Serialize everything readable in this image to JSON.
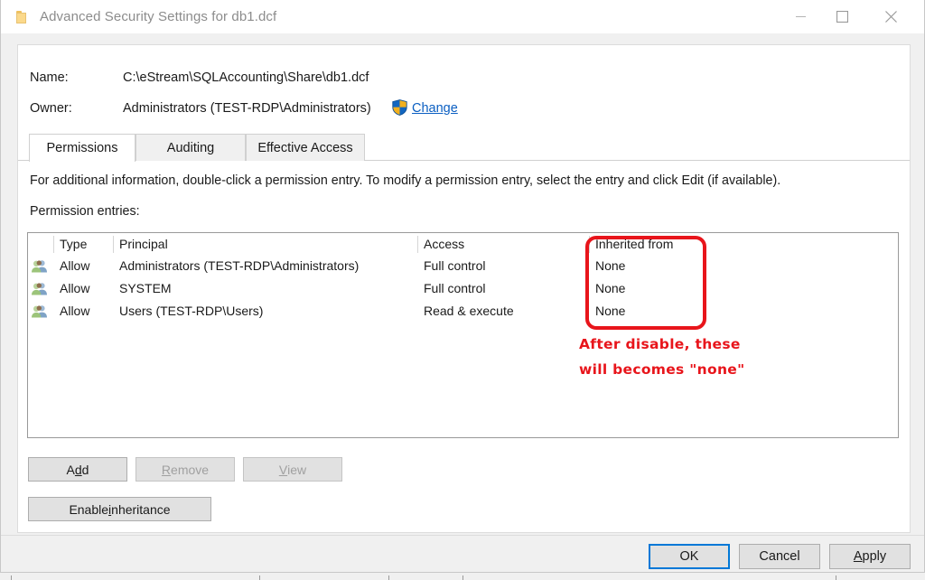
{
  "window": {
    "title": "Advanced Security Settings for db1.dcf",
    "icon": "folder-icon",
    "controls": {
      "minimize": "minimize-icon",
      "maximize": "maximize-icon",
      "close": "close-icon"
    }
  },
  "info": {
    "name_label": "Name:",
    "name_value": "C:\\eStream\\SQLAccounting\\Share\\db1.dcf",
    "owner_label": "Owner:",
    "owner_value": "Administrators (TEST-RDP\\Administrators)",
    "change_link": "Change",
    "shield_icon": "uac-shield-icon"
  },
  "tabs": [
    {
      "label": "Permissions",
      "active": true
    },
    {
      "label": "Auditing",
      "active": false
    },
    {
      "label": "Effective Access",
      "active": false
    }
  ],
  "main": {
    "description": "For additional information, double-click a permission entry. To modify a permission entry, select the entry and click Edit (if available).",
    "entries_caption": "Permission entries:"
  },
  "table": {
    "columns": [
      "Type",
      "Principal",
      "Access",
      "Inherited from"
    ],
    "rows": [
      {
        "icon": "group-icon",
        "type": "Allow",
        "principal": "Administrators (TEST-RDP\\Administrators)",
        "access": "Full control",
        "inherited_from": "None"
      },
      {
        "icon": "group-icon",
        "type": "Allow",
        "principal": "SYSTEM",
        "access": "Full control",
        "inherited_from": "None"
      },
      {
        "icon": "group-icon",
        "type": "Allow",
        "principal": "Users (TEST-RDP\\Users)",
        "access": "Read & execute",
        "inherited_from": "None"
      }
    ]
  },
  "buttons": {
    "add": {
      "pre": "A",
      "accel": "d",
      "post": "d",
      "enabled": true
    },
    "remove": {
      "pre": "",
      "accel": "R",
      "post": "emove",
      "enabled": false
    },
    "view": {
      "pre": "",
      "accel": "V",
      "post": "iew",
      "enabled": false
    },
    "enable_inheritance": {
      "pre": "Enable ",
      "accel": "i",
      "post": "nheritance",
      "enabled": true
    }
  },
  "command_bar": {
    "ok": "OK",
    "cancel": "Cancel",
    "apply_pre": "",
    "apply_accel": "A",
    "apply_post": "pply"
  },
  "annotations": {
    "highlight_box": "red-rounded-rectangle-around-inherited-from-column",
    "note_line_1": "After disable, these",
    "note_line_2": "will becomes \"none\"",
    "color": "#e8151b"
  },
  "colors": {
    "accent": "#0078d7",
    "link": "#0b5fc2",
    "annotation_red": "#e8151b",
    "titlebar_text": "#8c8c8c",
    "dialog_bg": "#f0f0f0",
    "panel_bg": "#ffffff"
  }
}
